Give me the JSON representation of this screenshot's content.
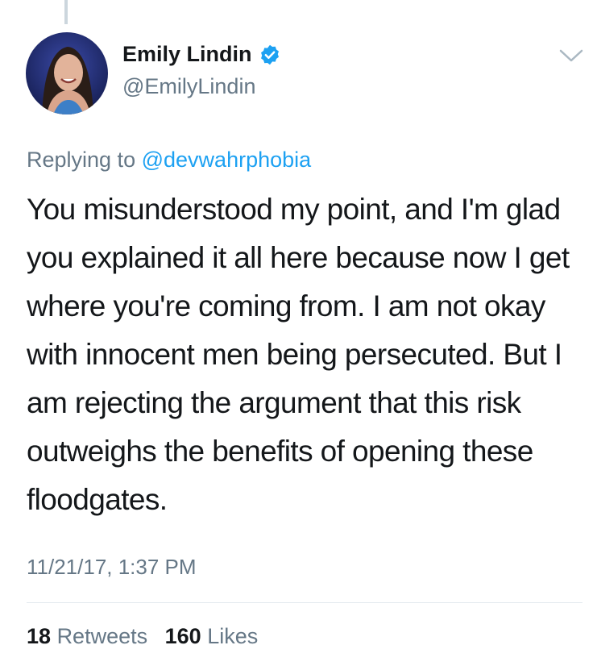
{
  "author": {
    "display_name": "Emily Lindin",
    "handle": "@EmilyLindin",
    "verified_icon": "verified-badge-icon",
    "avatar": "profile-photo"
  },
  "reply": {
    "prefix": "Replying to",
    "mention": "@devwahrphobia"
  },
  "tweet": {
    "text": "You misunderstood my point, and I'm glad you explained it all here because now I get where you're coming from. I am not okay with innocent men being persecuted. But I am rejecting the argument that this risk outweighs the benefits of opening these floodgates.",
    "timestamp": "11/21/17, 1:37 PM"
  },
  "stats": {
    "retweets_count": "18",
    "retweets_label": "Retweets",
    "likes_count": "160",
    "likes_label": "Likes"
  },
  "colors": {
    "link": "#1da1f2",
    "secondary_text": "#657786",
    "primary_text": "#14171a",
    "divider": "#e1e8ed"
  }
}
